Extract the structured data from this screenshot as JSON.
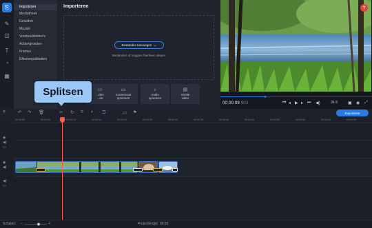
{
  "menu": {
    "items": [
      {
        "label": "Importeren",
        "active": true
      },
      {
        "label": "Mediatheek"
      },
      {
        "label": "Geluiden"
      },
      {
        "label": "Muziek"
      },
      {
        "label": "Voorbeeldvideo's"
      },
      {
        "label": "Achtergronden"
      },
      {
        "label": "Frames"
      },
      {
        "label": "Effectenpakketten"
      }
    ]
  },
  "panel": {
    "title": "Importeren",
    "browse_label": "Bestanden toevoegen",
    "drop_hint": "Bestanden of mappen hierheen slepen",
    "tiles": [
      {
        "label1": "...den",
        "label2": "...en",
        "icon": "folder-icon"
      },
      {
        "label1": "Screencast",
        "label2": "opnemen",
        "icon": "screen-icon"
      },
      {
        "label1": "Audio",
        "label2": "opnemen",
        "icon": "mic-icon"
      },
      {
        "label1": "Snelle",
        "label2": "video",
        "icon": "film-icon"
      }
    ]
  },
  "tooltip": {
    "text": "Splitsen"
  },
  "preview": {
    "help": "?",
    "time_main": "00:00:09",
    "time_ms": ".903",
    "zoom": "36.9"
  },
  "toolbar": {
    "export_label": "Exporteren"
  },
  "ruler": {
    "ticks": [
      "00:00:00",
      "00:00:05",
      "00:00:10",
      "00:00:15",
      "00:00:20",
      "00:00:25",
      "00:00:30",
      "00:00:35",
      "00:00:40",
      "00:00:45",
      "00:00:50",
      "00:00:55",
      "00:01:00",
      "00:01:05",
      "00:01:10"
    ]
  },
  "status": {
    "scale_label": "Schalen:",
    "length_label": "Projectlengte: 00:32"
  },
  "colors": {
    "accent": "#2a7ae2",
    "playhead": "#ff5a4e",
    "tooltip": "#9cc7f7",
    "help": "#e0433a"
  }
}
